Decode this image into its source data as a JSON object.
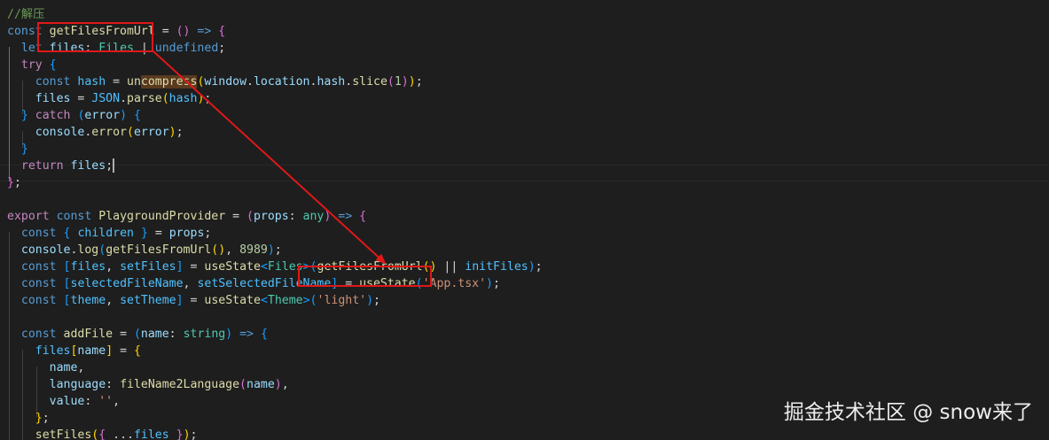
{
  "editor": {
    "lines": [
      [
        {
          "t": "//解压",
          "c": "comment"
        }
      ],
      [
        {
          "t": "const",
          "c": "kw"
        },
        {
          "t": " "
        },
        {
          "t": "getFilesFromUrl",
          "c": "fn"
        },
        {
          "t": " = "
        },
        {
          "t": "()",
          "c": "b2"
        },
        {
          "t": " "
        },
        {
          "t": "=>",
          "c": "kw"
        },
        {
          "t": " "
        },
        {
          "t": "{",
          "c": "b2"
        }
      ],
      [
        {
          "t": "  "
        },
        {
          "t": "let",
          "c": "kw"
        },
        {
          "t": " "
        },
        {
          "t": "files",
          "c": "var"
        },
        {
          "t": ": "
        },
        {
          "t": "Files",
          "c": "type"
        },
        {
          "t": " | "
        },
        {
          "t": "undefined",
          "c": "kw"
        },
        {
          "t": ";"
        }
      ],
      [
        {
          "t": "  "
        },
        {
          "t": "try",
          "c": "ctrl"
        },
        {
          "t": " "
        },
        {
          "t": "{",
          "c": "b3"
        }
      ],
      [
        {
          "t": "    "
        },
        {
          "t": "const",
          "c": "kw"
        },
        {
          "t": " "
        },
        {
          "t": "hash",
          "c": "const"
        },
        {
          "t": " = "
        },
        {
          "t": "un",
          "c": "fn"
        },
        {
          "t": "compress",
          "c": "fn",
          "hl": true
        },
        {
          "t": "(",
          "c": "b1"
        },
        {
          "t": "window",
          "c": "var"
        },
        {
          "t": "."
        },
        {
          "t": "location",
          "c": "var"
        },
        {
          "t": "."
        },
        {
          "t": "hash",
          "c": "var"
        },
        {
          "t": "."
        },
        {
          "t": "slice",
          "c": "fn"
        },
        {
          "t": "(",
          "c": "b2"
        },
        {
          "t": "1",
          "c": "num"
        },
        {
          "t": ")",
          "c": "b2"
        },
        {
          "t": ")",
          "c": "b1"
        },
        {
          "t": ";"
        }
      ],
      [
        {
          "t": "    "
        },
        {
          "t": "files",
          "c": "var"
        },
        {
          "t": " = "
        },
        {
          "t": "JSON",
          "c": "const"
        },
        {
          "t": "."
        },
        {
          "t": "parse",
          "c": "fn"
        },
        {
          "t": "(",
          "c": "b1"
        },
        {
          "t": "hash",
          "c": "const"
        },
        {
          "t": ")",
          "c": "b1"
        },
        {
          "t": ";"
        }
      ],
      [
        {
          "t": "  "
        },
        {
          "t": "}",
          "c": "b3"
        },
        {
          "t": " "
        },
        {
          "t": "catch",
          "c": "ctrl"
        },
        {
          "t": " "
        },
        {
          "t": "(",
          "c": "b3"
        },
        {
          "t": "error",
          "c": "var"
        },
        {
          "t": ")",
          "c": "b3"
        },
        {
          "t": " "
        },
        {
          "t": "{",
          "c": "b3"
        }
      ],
      [
        {
          "t": "    "
        },
        {
          "t": "console",
          "c": "var"
        },
        {
          "t": "."
        },
        {
          "t": "error",
          "c": "fn"
        },
        {
          "t": "(",
          "c": "b1"
        },
        {
          "t": "error",
          "c": "var"
        },
        {
          "t": ")",
          "c": "b1"
        },
        {
          "t": ";"
        }
      ],
      [
        {
          "t": "  "
        },
        {
          "t": "}",
          "c": "b3"
        }
      ],
      [
        {
          "t": "  "
        },
        {
          "t": "return",
          "c": "ctrl"
        },
        {
          "t": " "
        },
        {
          "t": "files",
          "c": "var"
        },
        {
          "t": ";"
        },
        {
          "t": "",
          "cursor": true
        }
      ],
      [
        {
          "t": "}",
          "c": "b2"
        },
        {
          "t": ";"
        }
      ],
      [],
      [
        {
          "t": "export",
          "c": "ctrl"
        },
        {
          "t": " "
        },
        {
          "t": "const",
          "c": "kw"
        },
        {
          "t": " "
        },
        {
          "t": "PlaygroundProvider",
          "c": "fn"
        },
        {
          "t": " = "
        },
        {
          "t": "(",
          "c": "b2"
        },
        {
          "t": "props",
          "c": "var"
        },
        {
          "t": ": "
        },
        {
          "t": "any",
          "c": "type"
        },
        {
          "t": ")",
          "c": "b2"
        },
        {
          "t": " "
        },
        {
          "t": "=>",
          "c": "kw"
        },
        {
          "t": " "
        },
        {
          "t": "{",
          "c": "b2"
        }
      ],
      [
        {
          "t": "  "
        },
        {
          "t": "const",
          "c": "kw"
        },
        {
          "t": " "
        },
        {
          "t": "{",
          "c": "b3"
        },
        {
          "t": " "
        },
        {
          "t": "children",
          "c": "const"
        },
        {
          "t": " "
        },
        {
          "t": "}",
          "c": "b3"
        },
        {
          "t": " = "
        },
        {
          "t": "props",
          "c": "var"
        },
        {
          "t": ";"
        }
      ],
      [
        {
          "t": "  "
        },
        {
          "t": "console",
          "c": "var"
        },
        {
          "t": "."
        },
        {
          "t": "log",
          "c": "fn"
        },
        {
          "t": "(",
          "c": "b3"
        },
        {
          "t": "getFilesFromUrl",
          "c": "fn"
        },
        {
          "t": "()",
          "c": "b1"
        },
        {
          "t": ", "
        },
        {
          "t": "8989",
          "c": "num"
        },
        {
          "t": ")",
          "c": "b3"
        },
        {
          "t": ";"
        }
      ],
      [
        {
          "t": "  "
        },
        {
          "t": "const",
          "c": "kw"
        },
        {
          "t": " "
        },
        {
          "t": "[",
          "c": "b3"
        },
        {
          "t": "files",
          "c": "const"
        },
        {
          "t": ", "
        },
        {
          "t": "setFiles",
          "c": "const"
        },
        {
          "t": "]",
          "c": "b3"
        },
        {
          "t": " = "
        },
        {
          "t": "useState",
          "c": "fn"
        },
        {
          "t": "<",
          "c": "b3"
        },
        {
          "t": "Files",
          "c": "type"
        },
        {
          "t": ">",
          "c": "b3"
        },
        {
          "t": "(",
          "c": "b3"
        },
        {
          "t": "getFilesFromUrl",
          "c": "fn"
        },
        {
          "t": "()",
          "c": "b1"
        },
        {
          "t": " || "
        },
        {
          "t": "initFiles",
          "c": "const"
        },
        {
          "t": ")",
          "c": "b3"
        },
        {
          "t": ";"
        }
      ],
      [
        {
          "t": "  "
        },
        {
          "t": "const",
          "c": "kw"
        },
        {
          "t": " "
        },
        {
          "t": "[",
          "c": "b3"
        },
        {
          "t": "selectedFileName",
          "c": "const"
        },
        {
          "t": ", "
        },
        {
          "t": "setSelectedFileName",
          "c": "const"
        },
        {
          "t": "]",
          "c": "b3"
        },
        {
          "t": " = "
        },
        {
          "t": "useState",
          "c": "fn"
        },
        {
          "t": "(",
          "c": "b3"
        },
        {
          "t": "'App.tsx'",
          "c": "str"
        },
        {
          "t": ")",
          "c": "b3"
        },
        {
          "t": ";"
        }
      ],
      [
        {
          "t": "  "
        },
        {
          "t": "const",
          "c": "kw"
        },
        {
          "t": " "
        },
        {
          "t": "[",
          "c": "b3"
        },
        {
          "t": "theme",
          "c": "const"
        },
        {
          "t": ", "
        },
        {
          "t": "setTheme",
          "c": "const"
        },
        {
          "t": "]",
          "c": "b3"
        },
        {
          "t": " = "
        },
        {
          "t": "useState",
          "c": "fn"
        },
        {
          "t": "<",
          "c": "b3"
        },
        {
          "t": "Theme",
          "c": "type"
        },
        {
          "t": ">",
          "c": "b3"
        },
        {
          "t": "(",
          "c": "b3"
        },
        {
          "t": "'light'",
          "c": "str"
        },
        {
          "t": ")",
          "c": "b3"
        },
        {
          "t": ";"
        }
      ],
      [],
      [
        {
          "t": "  "
        },
        {
          "t": "const",
          "c": "kw"
        },
        {
          "t": " "
        },
        {
          "t": "addFile",
          "c": "fn"
        },
        {
          "t": " = "
        },
        {
          "t": "(",
          "c": "b3"
        },
        {
          "t": "name",
          "c": "var"
        },
        {
          "t": ": "
        },
        {
          "t": "string",
          "c": "type"
        },
        {
          "t": ")",
          "c": "b3"
        },
        {
          "t": " "
        },
        {
          "t": "=>",
          "c": "kw"
        },
        {
          "t": " "
        },
        {
          "t": "{",
          "c": "b3"
        }
      ],
      [
        {
          "t": "    "
        },
        {
          "t": "files",
          "c": "const"
        },
        {
          "t": "[",
          "c": "b1"
        },
        {
          "t": "name",
          "c": "var"
        },
        {
          "t": "]",
          "c": "b1"
        },
        {
          "t": " = "
        },
        {
          "t": "{",
          "c": "b1"
        }
      ],
      [
        {
          "t": "      "
        },
        {
          "t": "name",
          "c": "var"
        },
        {
          "t": ","
        }
      ],
      [
        {
          "t": "      "
        },
        {
          "t": "language",
          "c": "var"
        },
        {
          "t": ": "
        },
        {
          "t": "fileName2Language",
          "c": "fn"
        },
        {
          "t": "(",
          "c": "b2"
        },
        {
          "t": "name",
          "c": "var"
        },
        {
          "t": ")",
          "c": "b2"
        },
        {
          "t": ","
        }
      ],
      [
        {
          "t": "      "
        },
        {
          "t": "value",
          "c": "var"
        },
        {
          "t": ": "
        },
        {
          "t": "''",
          "c": "str"
        },
        {
          "t": ","
        }
      ],
      [
        {
          "t": "    "
        },
        {
          "t": "}",
          "c": "b1"
        },
        {
          "t": ";"
        }
      ],
      [
        {
          "t": "    "
        },
        {
          "t": "setFiles",
          "c": "fn"
        },
        {
          "t": "(",
          "c": "b1"
        },
        {
          "t": "{",
          "c": "b2"
        },
        {
          "t": " "
        },
        {
          "t": "...",
          "c": "op"
        },
        {
          "t": "files",
          "c": "const"
        },
        {
          "t": " "
        },
        {
          "t": "}",
          "c": "b2"
        },
        {
          "t": ")",
          "c": "b1"
        },
        {
          "t": ";"
        }
      ]
    ]
  },
  "watermark": {
    "text": "掘金技术社区 @ snow来了"
  }
}
